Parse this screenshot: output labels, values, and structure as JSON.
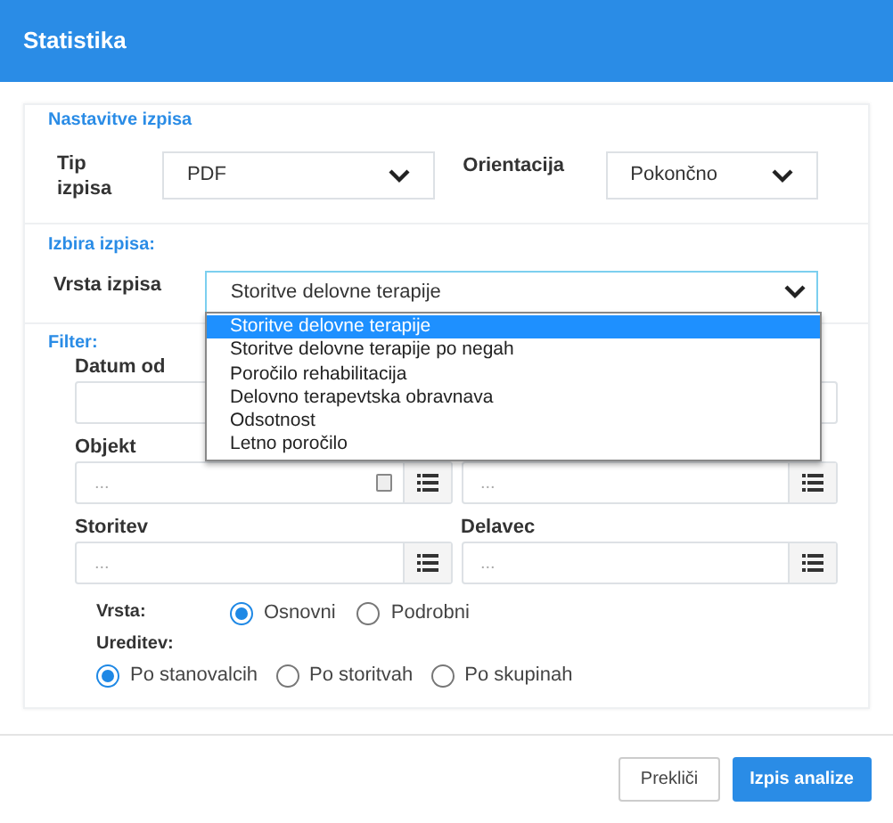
{
  "dialog": {
    "title": "Statistika"
  },
  "settings": {
    "heading": "Nastavitve izpisa",
    "type_label": "Tip izpisa",
    "type_value": "PDF",
    "orientation_label": "Orientacija",
    "orientation_value": "Pokončno"
  },
  "selection": {
    "heading": "Izbira izpisa:",
    "label": "Vrsta izpisa",
    "value": "Storitve delovne terapije",
    "options": [
      {
        "label": "Storitve delovne terapije",
        "selected": true
      },
      {
        "label": "Storitve delovne terapije po negah",
        "selected": false
      },
      {
        "label": "Poročilo rehabilitacija",
        "selected": false
      },
      {
        "label": "Delovno terapevtska obravnava",
        "selected": false
      },
      {
        "label": "Odsotnost",
        "selected": false
      },
      {
        "label": "Letno poročilo",
        "selected": false
      }
    ]
  },
  "filter": {
    "heading": "Filter:",
    "date_from_label": "Datum od",
    "fields": [
      {
        "label": "Objekt",
        "placeholder": "..."
      },
      {
        "placeholder": "..."
      },
      {
        "label": "Storitev",
        "placeholder": "..."
      },
      {
        "label": "Delavec",
        "placeholder": "..."
      }
    ],
    "type_label": "Vrsta:",
    "type_options": [
      {
        "label": "Osnovni",
        "selected": true
      },
      {
        "label": "Podrobni",
        "selected": false
      }
    ],
    "sort_label": "Ureditev:",
    "sort_options": [
      {
        "label": "Po stanovalcih",
        "selected": true
      },
      {
        "label": "Po storitvah",
        "selected": false
      },
      {
        "label": "Po skupinah",
        "selected": false
      }
    ]
  },
  "buttons": {
    "cancel": "Prekliči",
    "submit": "Izpis analize"
  }
}
